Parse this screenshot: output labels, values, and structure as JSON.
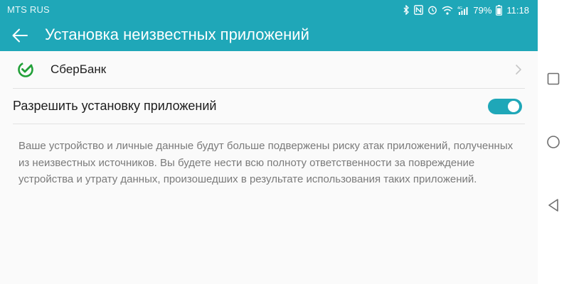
{
  "status_bar": {
    "carrier": "MTS RUS",
    "battery_percent": "79%",
    "time": "11:18",
    "icons": [
      "bluetooth-icon",
      "nfc-icon",
      "alarm-icon",
      "wifi-icon",
      "lte-signal-icon",
      "battery-icon"
    ]
  },
  "toolbar": {
    "back_icon": "arrow-left-icon",
    "title": "Установка неизвестных приложений"
  },
  "app_row": {
    "icon": "sberbank-logo",
    "name": "СберБанк",
    "chevron_icon": "chevron-right-icon"
  },
  "toggle_row": {
    "label": "Разрешить установку приложений",
    "enabled": true
  },
  "warning": {
    "text": "Ваше устройство и личные данные будут больше подвержены риску атак приложений, полученных из неизвестных источников. Вы будете нести всю полноту ответственности за повреждение устройства и утрату данных, произошедших в результате использования таких приложений."
  },
  "nav_bar": {
    "buttons": [
      "recents-square-icon",
      "home-circle-icon",
      "back-triangle-icon"
    ]
  },
  "colors": {
    "accent": "#1fa7b8",
    "sber_green": "#21a038",
    "secondary_text": "#7a7a7a"
  }
}
